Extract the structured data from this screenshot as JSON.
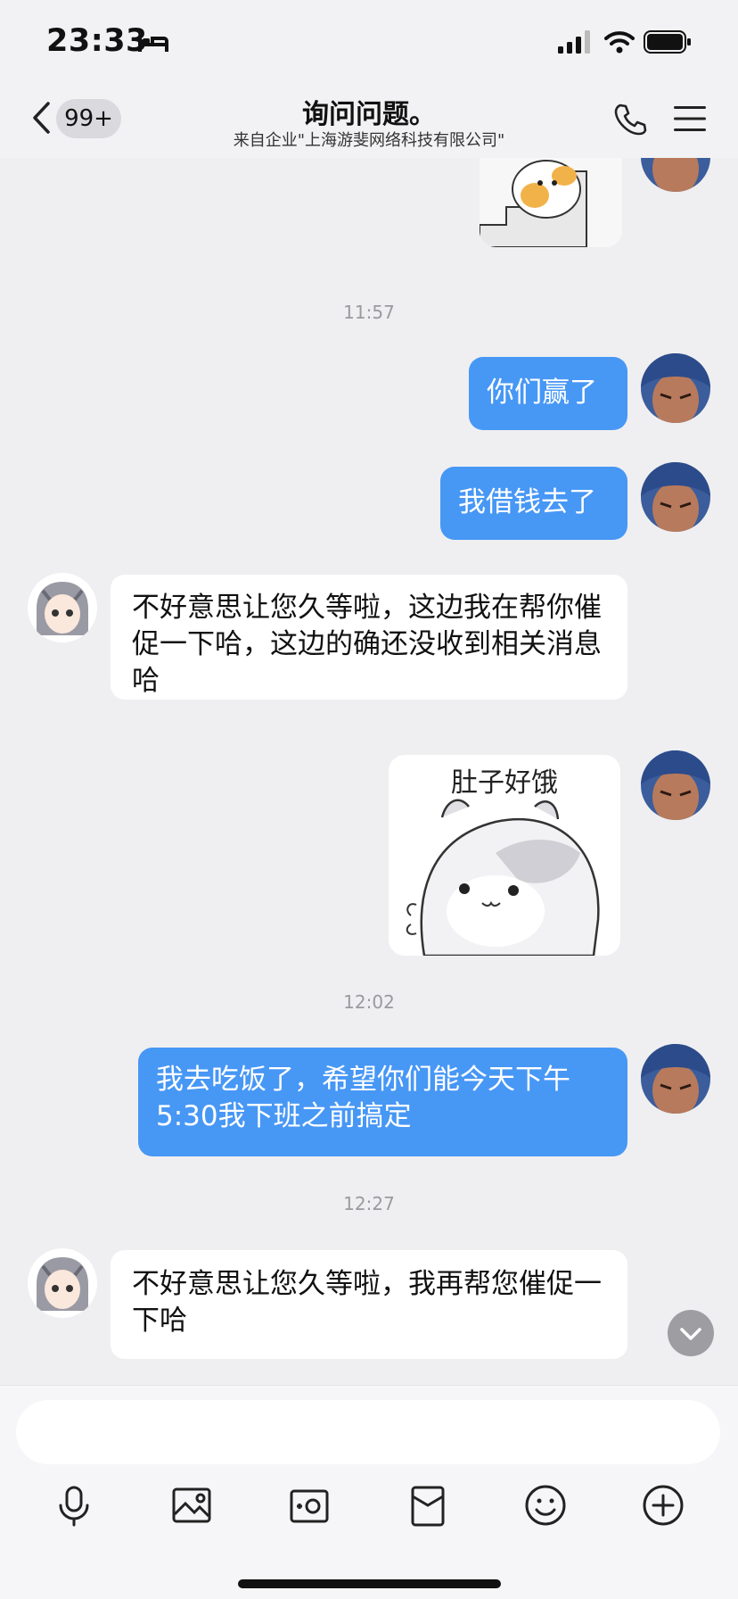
{
  "status_bar": {
    "time": "23:33"
  },
  "header": {
    "unread_badge": "99+",
    "title": "询问问题。",
    "subtitle": "来自企业\"上海游斐网络科技有限公司\""
  },
  "timestamps": [
    "11:57",
    "12:02",
    "12:27"
  ],
  "messages": [
    {
      "from": "me",
      "text": "你们赢了"
    },
    {
      "from": "me",
      "text": "我借钱去了"
    },
    {
      "from": "them",
      "text": "不好意思让您久等啦，这边我在帮你催促一下哈，这边的确还没收到相关消息哈"
    },
    {
      "from": "me",
      "sticker_text": "肚子好饿"
    },
    {
      "from": "me",
      "text": "我去吃饭了，希望你们能今天下午5:30我下班之前搞定"
    },
    {
      "from": "them",
      "text": "不好意思让您久等啦，我再帮您催促一下哈"
    }
  ],
  "toolbar": {
    "icons": [
      "microphone-icon",
      "image-icon",
      "camera-icon",
      "red-packet-icon",
      "emoji-icon",
      "plus-icon"
    ]
  },
  "colors": {
    "my_bubble": "#4797f5",
    "their_bubble": "#ffffff",
    "background": "#efeff1"
  }
}
